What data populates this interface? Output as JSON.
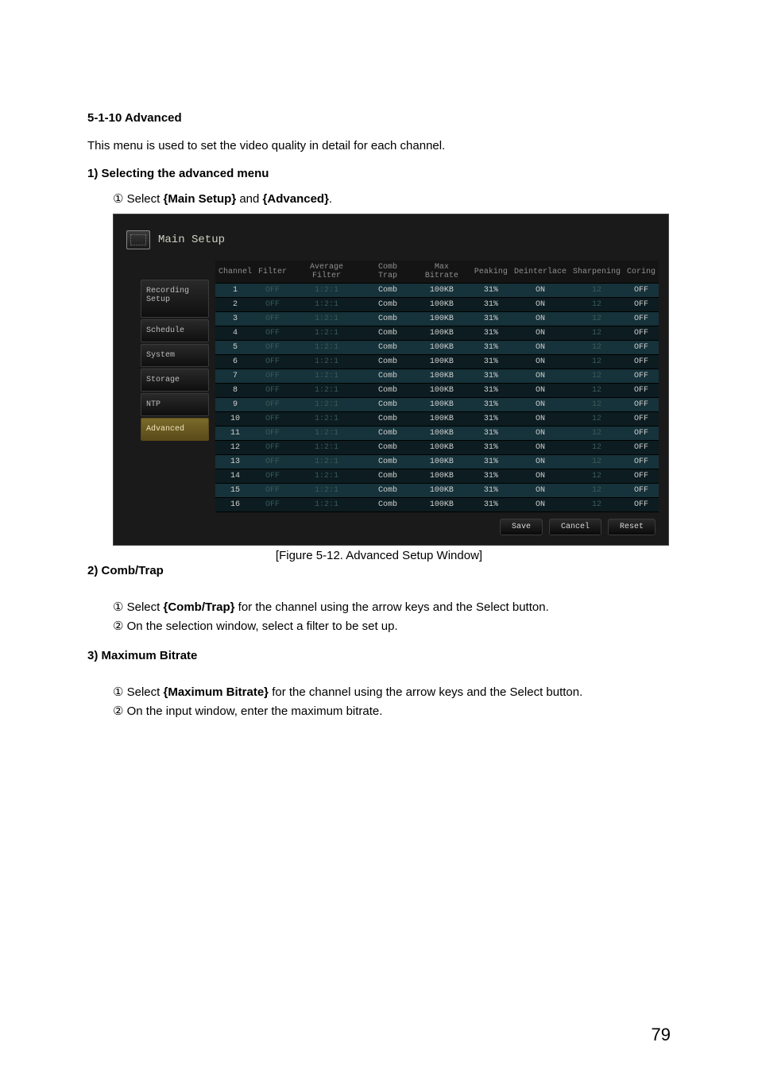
{
  "doc": {
    "sec_num": "5-1-10  Advanced",
    "intro": "This menu is used to set the video quality in detail for each channel.",
    "section1_title": "1)  Selecting the advanced menu",
    "section1_step1_prefix": "① Select ",
    "section1_step1_bold1": "{Main Setup}",
    "section1_step1_mid": " and ",
    "section1_step1_bold2": "{Advanced}",
    "section1_step1_suffix": ".",
    "figure_caption": "[Figure 5-12. Advanced Setup Window]",
    "section2_title": "2) Comb/Trap",
    "section2_step1_prefix": "① Select ",
    "section2_step1_bold": "{Comb/Trap}",
    "section2_step1_suffix": " for the channel using the arrow keys and the Select button.",
    "section2_step2": "② On the selection window, select a filter to be set up.",
    "section3_title": "3) Maximum Bitrate",
    "section3_step1_prefix": "① Select ",
    "section3_step1_bold": "{Maximum Bitrate}",
    "section3_step1_suffix": " for the channel using the arrow keys and the Select button.",
    "section3_step2": "② On the input window, enter the maximum bitrate.",
    "page_number": "79"
  },
  "ui": {
    "window_title": "Main Setup",
    "tabs": [
      "Recording Setup",
      "Schedule",
      "System",
      "Storage",
      "NTP",
      "Advanced"
    ],
    "active_tab_index": 5,
    "columns": [
      "Channel",
      "Filter",
      "Average Filter",
      "Comb Trap",
      "Max Bitrate",
      "Peaking",
      "Deinterlace",
      "Sharpening",
      "Coring"
    ],
    "rows": [
      {
        "ch": "1",
        "filter": "OFF",
        "avg": "1:2:1",
        "comb": "Comb",
        "bitrate": "100KB",
        "peak": "31%",
        "deint": "ON",
        "sharp": "12",
        "coring": "OFF"
      },
      {
        "ch": "2",
        "filter": "OFF",
        "avg": "1:2:1",
        "comb": "Comb",
        "bitrate": "100KB",
        "peak": "31%",
        "deint": "ON",
        "sharp": "12",
        "coring": "OFF"
      },
      {
        "ch": "3",
        "filter": "OFF",
        "avg": "1:2:1",
        "comb": "Comb",
        "bitrate": "100KB",
        "peak": "31%",
        "deint": "ON",
        "sharp": "12",
        "coring": "OFF"
      },
      {
        "ch": "4",
        "filter": "OFF",
        "avg": "1:2:1",
        "comb": "Comb",
        "bitrate": "100KB",
        "peak": "31%",
        "deint": "ON",
        "sharp": "12",
        "coring": "OFF"
      },
      {
        "ch": "5",
        "filter": "OFF",
        "avg": "1:2:1",
        "comb": "Comb",
        "bitrate": "100KB",
        "peak": "31%",
        "deint": "ON",
        "sharp": "12",
        "coring": "OFF"
      },
      {
        "ch": "6",
        "filter": "OFF",
        "avg": "1:2:1",
        "comb": "Comb",
        "bitrate": "100KB",
        "peak": "31%",
        "deint": "ON",
        "sharp": "12",
        "coring": "OFF"
      },
      {
        "ch": "7",
        "filter": "OFF",
        "avg": "1:2:1",
        "comb": "Comb",
        "bitrate": "100KB",
        "peak": "31%",
        "deint": "ON",
        "sharp": "12",
        "coring": "OFF"
      },
      {
        "ch": "8",
        "filter": "OFF",
        "avg": "1:2:1",
        "comb": "Comb",
        "bitrate": "100KB",
        "peak": "31%",
        "deint": "ON",
        "sharp": "12",
        "coring": "OFF"
      },
      {
        "ch": "9",
        "filter": "OFF",
        "avg": "1:2:1",
        "comb": "Comb",
        "bitrate": "100KB",
        "peak": "31%",
        "deint": "ON",
        "sharp": "12",
        "coring": "OFF"
      },
      {
        "ch": "10",
        "filter": "OFF",
        "avg": "1:2:1",
        "comb": "Comb",
        "bitrate": "100KB",
        "peak": "31%",
        "deint": "ON",
        "sharp": "12",
        "coring": "OFF"
      },
      {
        "ch": "11",
        "filter": "OFF",
        "avg": "1:2:1",
        "comb": "Comb",
        "bitrate": "100KB",
        "peak": "31%",
        "deint": "ON",
        "sharp": "12",
        "coring": "OFF"
      },
      {
        "ch": "12",
        "filter": "OFF",
        "avg": "1:2:1",
        "comb": "Comb",
        "bitrate": "100KB",
        "peak": "31%",
        "deint": "ON",
        "sharp": "12",
        "coring": "OFF"
      },
      {
        "ch": "13",
        "filter": "OFF",
        "avg": "1:2:1",
        "comb": "Comb",
        "bitrate": "100KB",
        "peak": "31%",
        "deint": "ON",
        "sharp": "12",
        "coring": "OFF"
      },
      {
        "ch": "14",
        "filter": "OFF",
        "avg": "1:2:1",
        "comb": "Comb",
        "bitrate": "100KB",
        "peak": "31%",
        "deint": "ON",
        "sharp": "12",
        "coring": "OFF"
      },
      {
        "ch": "15",
        "filter": "OFF",
        "avg": "1:2:1",
        "comb": "Comb",
        "bitrate": "100KB",
        "peak": "31%",
        "deint": "ON",
        "sharp": "12",
        "coring": "OFF"
      },
      {
        "ch": "16",
        "filter": "OFF",
        "avg": "1:2:1",
        "comb": "Comb",
        "bitrate": "100KB",
        "peak": "31%",
        "deint": "ON",
        "sharp": "12",
        "coring": "OFF"
      }
    ],
    "buttons": {
      "save": "Save",
      "cancel": "Cancel",
      "reset": "Reset"
    }
  }
}
